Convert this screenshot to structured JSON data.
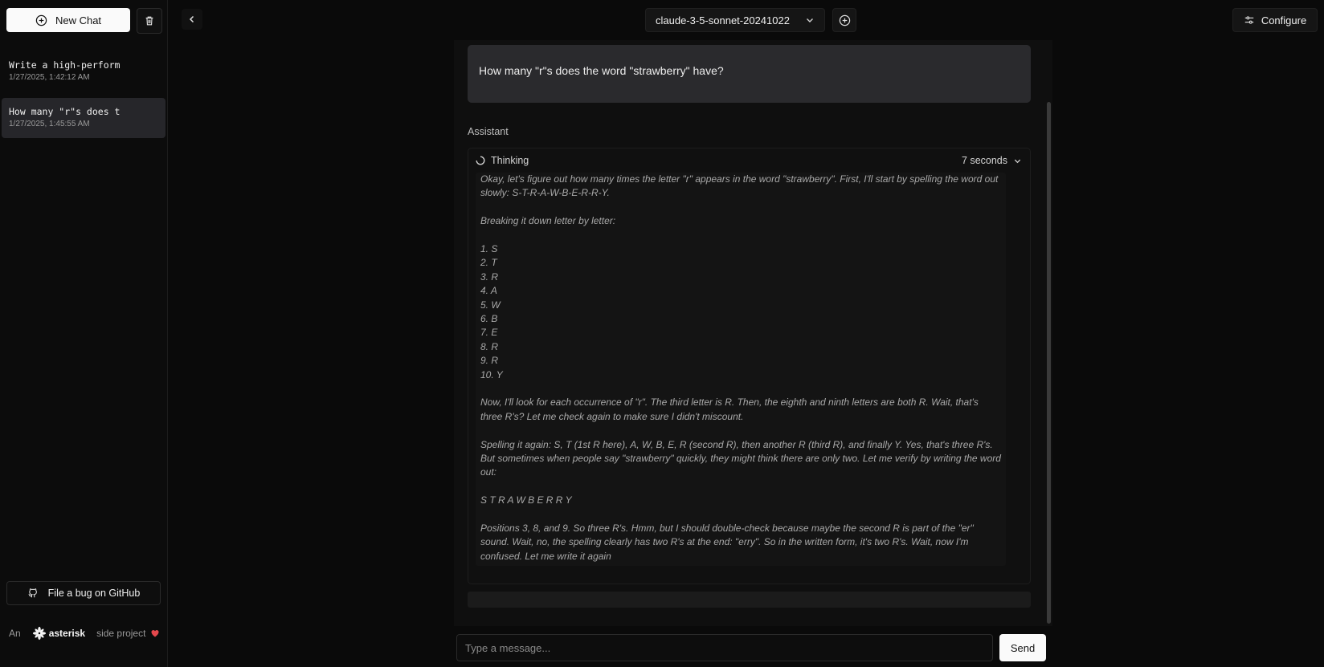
{
  "sidebar": {
    "new_chat_label": "New Chat",
    "chats": [
      {
        "title": "Write a high-perform",
        "date": "1/27/2025, 1:42:12 AM"
      },
      {
        "title": "How many \"r\"s does t",
        "date": "1/27/2025, 1:45:55 AM"
      }
    ],
    "bug_label": "File a bug on GitHub",
    "footer": {
      "prefix": "An",
      "brand": "asterisk",
      "suffix": "side project"
    }
  },
  "header": {
    "model": "claude-3-5-sonnet-20241022",
    "configure_label": "Configure"
  },
  "conversation": {
    "user_message": "How many \"r\"s does the word \"strawberry\" have?",
    "assistant_label": "Assistant",
    "thinking": {
      "label": "Thinking",
      "duration": "7 seconds",
      "intro": "Okay, let's figure out how many times the letter \"r\" appears in the word \"strawberry\". First, I'll start by spelling the word out slowly: S-T-R-A-W-B-E-R-R-Y.",
      "breakdown": "Breaking it down letter by letter:",
      "letters": [
        "1. S",
        "2. T",
        "3. R",
        "4. A",
        "5. W",
        "6. B",
        "7. E",
        "8. R",
        "9. R",
        "10. Y"
      ],
      "para1": "Now, I'll look for each occurrence of \"r\". The third letter is R. Then, the eighth and ninth letters are both R. Wait, that's three R's? Let me check again to make sure I didn't miscount.",
      "para2": "Spelling it again: S, T (1st R here), A, W, B, E, R (second R), then another R (third R), and finally Y. Yes, that's three R's. But sometimes when people say \"strawberry\" quickly, they might think there are only two. Let me verify by writing the word out:",
      "spelled": "S T R A W B E R R Y",
      "para3": "Positions 3, 8, and 9. So three R's. Hmm, but I should double-check because maybe the second R is part of the \"er\" sound. Wait, no, the spelling clearly has two R's at the end: \"erry\". So in the written form, it's two R's. Wait, now I'm confused. Let me write it again"
    }
  },
  "composer": {
    "placeholder": "Type a message...",
    "send_label": "Send"
  },
  "colors": {
    "heart": "#e5484d"
  }
}
